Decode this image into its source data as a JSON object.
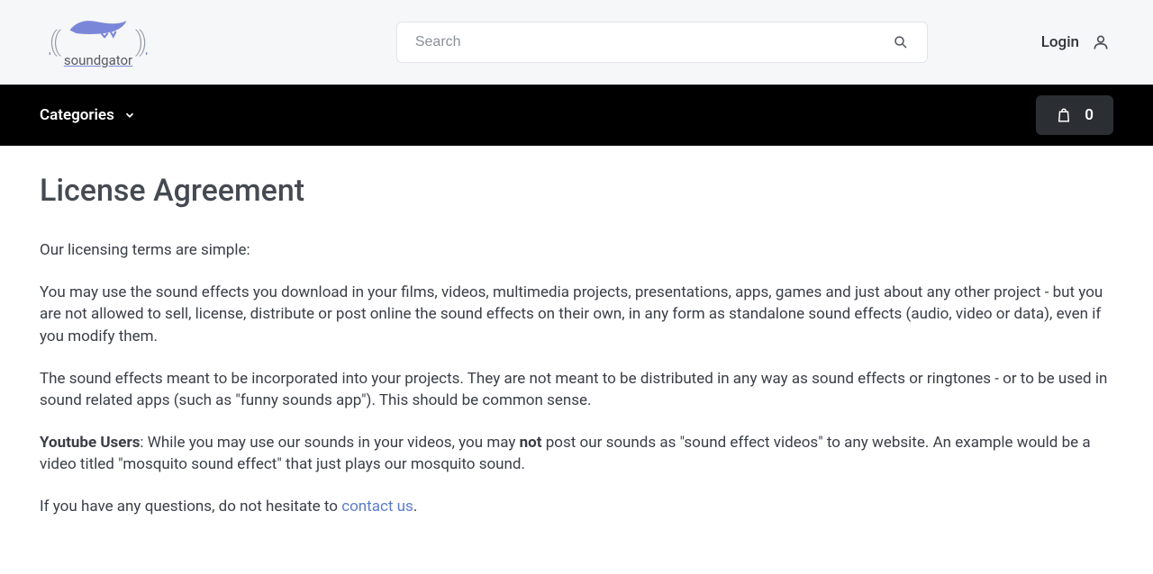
{
  "header": {
    "brand": "soundgator",
    "search_placeholder": "Search",
    "login_label": "Login"
  },
  "nav": {
    "categories_label": "Categories",
    "cart_count": "0"
  },
  "page": {
    "title": "License Agreement",
    "p1": "Our licensing terms are simple:",
    "p2": "You may use the sound effects you download in your films, videos, multimedia projects, presentations, apps, games and just about any other project - but you are not allowed to sell, license, distribute or post online the sound effects on their own, in any form as standalone sound effects (audio, video or data), even if you modify them.",
    "p3": "The sound effects meant to be incorporated into your projects. They are not meant to be distributed in any way as sound effects or ringtones - or to be used in sound related apps (such as \"funny sounds app\"). This should be common sense.",
    "yt_label": "Youtube Users",
    "yt_mid1": ": While you may use our sounds in your videos, you may ",
    "yt_not": "not",
    "yt_mid2": " post our sounds as \"sound effect videos\" to any website. An example would be a video titled \"mosquito sound effect\" that just plays our mosquito sound.",
    "p5a": "If you have any questions, do not hesitate to ",
    "contact_label": "contact us",
    "p5b": "."
  }
}
